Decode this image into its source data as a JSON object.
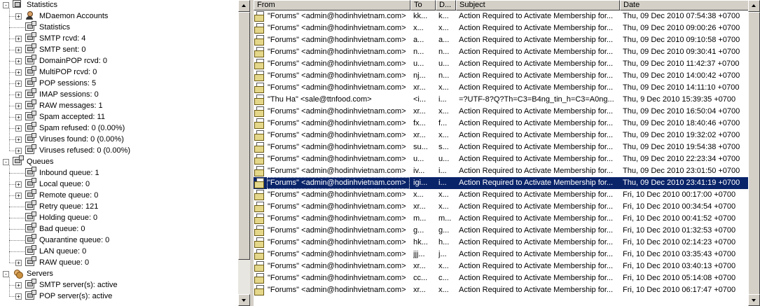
{
  "tree": {
    "root": {
      "label": "Statistics",
      "icon": "statistics-monitor-icon"
    },
    "stat_items": [
      {
        "label": "MDaemon Accounts",
        "icon": "user-icon",
        "expander": "+"
      },
      {
        "label": "Statistics",
        "icon": "stat-node-icon",
        "expander": ""
      },
      {
        "label": "SMTP rcvd: 4",
        "icon": "stat-node-icon",
        "expander": "+"
      },
      {
        "label": "SMTP sent: 0",
        "icon": "stat-node-icon",
        "expander": "+"
      },
      {
        "label": "DomainPOP rcvd: 0",
        "icon": "stat-node-icon",
        "expander": "+"
      },
      {
        "label": "MultiPOP rcvd: 0",
        "icon": "stat-node-icon",
        "expander": "+"
      },
      {
        "label": "POP sessions: 5",
        "icon": "stat-node-icon",
        "expander": "+"
      },
      {
        "label": "IMAP sessions: 0",
        "icon": "stat-node-icon",
        "expander": "+"
      },
      {
        "label": "RAW messages: 1",
        "icon": "stat-node-icon",
        "expander": "+"
      },
      {
        "label": "Spam accepted: 11",
        "icon": "stat-node-icon",
        "expander": "+"
      },
      {
        "label": "Spam refused: 0  (0.00%)",
        "icon": "stat-node-icon",
        "expander": "+"
      },
      {
        "label": "Viruses found: 0  (0.00%)",
        "icon": "stat-node-icon",
        "expander": "+"
      },
      {
        "label": "Viruses refused: 0  (0.00%)",
        "icon": "stat-node-icon",
        "expander": "+"
      }
    ],
    "queues": {
      "label": "Queues",
      "icon": "queues-icon"
    },
    "queue_items": [
      {
        "label": "Inbound queue: 1",
        "icon": "queue-node-icon",
        "expander": ""
      },
      {
        "label": "Local queue: 0",
        "icon": "queue-node-icon",
        "expander": "+"
      },
      {
        "label": "Remote queue: 0",
        "icon": "queue-node-icon",
        "expander": "+"
      },
      {
        "label": "Retry queue: 121",
        "icon": "queue-node-icon",
        "expander": ""
      },
      {
        "label": "Holding queue: 0",
        "icon": "queue-node-icon",
        "expander": ""
      },
      {
        "label": "Bad queue: 0",
        "icon": "queue-node-icon",
        "expander": ""
      },
      {
        "label": "Quarantine queue: 0",
        "icon": "queue-node-icon",
        "expander": ""
      },
      {
        "label": "LAN queue: 0",
        "icon": "queue-node-icon",
        "expander": ""
      },
      {
        "label": "RAW queue: 0",
        "icon": "queue-node-icon",
        "expander": "+"
      }
    ],
    "servers": {
      "label": "Servers",
      "icon": "servers-icon"
    },
    "server_items": [
      {
        "label": "SMTP server(s): active",
        "icon": "server-node-icon",
        "expander": "+"
      },
      {
        "label": "POP server(s): active",
        "icon": "server-node-icon",
        "expander": "+"
      }
    ]
  },
  "list": {
    "columns": [
      "From",
      "To",
      "D...",
      "Subject",
      "Date"
    ],
    "selected_index": 14,
    "rows": [
      {
        "from": "\"Forums\" <admin@hodinhvietnam.com>",
        "to": "kk...",
        "d": "k...",
        "subject": "Action Required to Activate Membership for...",
        "date": "Thu, 09 Dec 2010 07:54:38 +0700"
      },
      {
        "from": "\"Forums\" <admin@hodinhvietnam.com>",
        "to": "x...",
        "d": "x...",
        "subject": "Action Required to Activate Membership for...",
        "date": "Thu, 09 Dec 2010 09:00:26 +0700"
      },
      {
        "from": "\"Forums\" <admin@hodinhvietnam.com>",
        "to": "a...",
        "d": "a...",
        "subject": "Action Required to Activate Membership for...",
        "date": "Thu, 09 Dec 2010 09:10:58 +0700"
      },
      {
        "from": "\"Forums\" <admin@hodinhvietnam.com>",
        "to": "n...",
        "d": "n...",
        "subject": "Action Required to Activate Membership for...",
        "date": "Thu, 09 Dec 2010 09:30:41 +0700"
      },
      {
        "from": "\"Forums\" <admin@hodinhvietnam.com>",
        "to": "u...",
        "d": "u...",
        "subject": "Action Required to Activate Membership for...",
        "date": "Thu, 09 Dec 2010 11:42:37 +0700"
      },
      {
        "from": "\"Forums\" <admin@hodinhvietnam.com>",
        "to": "nj...",
        "d": "n...",
        "subject": "Action Required to Activate Membership for...",
        "date": "Thu, 09 Dec 2010 14:00:42 +0700"
      },
      {
        "from": "\"Forums\" <admin@hodinhvietnam.com>",
        "to": "xr...",
        "d": "x...",
        "subject": "Action Required to Activate Membership for...",
        "date": "Thu, 09 Dec 2010 14:11:10 +0700"
      },
      {
        "from": "\"Thu Ha\" <sale@ttnfood.com>",
        "to": "<i...",
        "d": "i...",
        "subject": "=?UTF-8?Q?Th=C3=B4ng_tin_h=C3=A0ng...",
        "date": "Thu, 9 Dec 2010 15:39:35 +0700"
      },
      {
        "from": "\"Forums\" <admin@hodinhvietnam.com>",
        "to": "xr...",
        "d": "x...",
        "subject": "Action Required to Activate Membership for...",
        "date": "Thu, 09 Dec 2010 16:50:04 +0700"
      },
      {
        "from": "\"Forums\" <admin@hodinhvietnam.com>",
        "to": "fx...",
        "d": "f...",
        "subject": "Action Required to Activate Membership for...",
        "date": "Thu, 09 Dec 2010 18:40:46 +0700"
      },
      {
        "from": "\"Forums\" <admin@hodinhvietnam.com>",
        "to": "xr...",
        "d": "x...",
        "subject": "Action Required to Activate Membership for...",
        "date": "Thu, 09 Dec 2010 19:32:02 +0700"
      },
      {
        "from": "\"Forums\" <admin@hodinhvietnam.com>",
        "to": "su...",
        "d": "s...",
        "subject": "Action Required to Activate Membership for...",
        "date": "Thu, 09 Dec 2010 19:54:38 +0700"
      },
      {
        "from": "\"Forums\" <admin@hodinhvietnam.com>",
        "to": "u...",
        "d": "u...",
        "subject": "Action Required to Activate Membership for...",
        "date": "Thu, 09 Dec 2010 22:23:34 +0700"
      },
      {
        "from": "\"Forums\" <admin@hodinhvietnam.com>",
        "to": "iv...",
        "d": "i...",
        "subject": "Action Required to Activate Membership for...",
        "date": "Thu, 09 Dec 2010 23:01:50 +0700"
      },
      {
        "from": "\"Forums\" <admin@hodinhvietnam.com>",
        "to": "igi...",
        "d": "i...",
        "subject": "Action Required to Activate Membership for...",
        "date": "Thu, 09 Dec 2010 23:41:19 +0700"
      },
      {
        "from": "\"Forums\" <admin@hodinhvietnam.com>",
        "to": "x...",
        "d": "x...",
        "subject": "Action Required to Activate Membership for...",
        "date": "Fri, 10 Dec 2010 00:17:00 +0700"
      },
      {
        "from": "\"Forums\" <admin@hodinhvietnam.com>",
        "to": "xr...",
        "d": "x...",
        "subject": "Action Required to Activate Membership for...",
        "date": "Fri, 10 Dec 2010 00:34:54 +0700"
      },
      {
        "from": "\"Forums\" <admin@hodinhvietnam.com>",
        "to": "m...",
        "d": "m...",
        "subject": "Action Required to Activate Membership for...",
        "date": "Fri, 10 Dec 2010 00:41:52 +0700"
      },
      {
        "from": "\"Forums\" <admin@hodinhvietnam.com>",
        "to": "g...",
        "d": "g...",
        "subject": "Action Required to Activate Membership for...",
        "date": "Fri, 10 Dec 2010 01:32:53 +0700"
      },
      {
        "from": "\"Forums\" <admin@hodinhvietnam.com>",
        "to": "hk...",
        "d": "h...",
        "subject": "Action Required to Activate Membership for...",
        "date": "Fri, 10 Dec 2010 02:14:23 +0700"
      },
      {
        "from": "\"Forums\" <admin@hodinhvietnam.com>",
        "to": "jjj...",
        "d": "j...",
        "subject": "Action Required to Activate Membership for...",
        "date": "Fri, 10 Dec 2010 03:35:43 +0700"
      },
      {
        "from": "\"Forums\" <admin@hodinhvietnam.com>",
        "to": "xr...",
        "d": "x...",
        "subject": "Action Required to Activate Membership for...",
        "date": "Fri, 10 Dec 2010 03:40:13 +0700"
      },
      {
        "from": "\"Forums\" <admin@hodinhvietnam.com>",
        "to": "cc...",
        "d": "c...",
        "subject": "Action Required to Activate Membership for...",
        "date": "Fri, 10 Dec 2010 05:14:08 +0700"
      },
      {
        "from": "\"Forums\" <admin@hodinhvietnam.com>",
        "to": "xr...",
        "d": "x...",
        "subject": "Action Required to Activate Membership for...",
        "date": "Fri, 10 Dec 2010 06:17:47 +0700"
      }
    ]
  },
  "colors": {
    "selection": "#0a246a",
    "chrome": "#d4d0c8",
    "scroll_track": "#e8e6e0"
  }
}
